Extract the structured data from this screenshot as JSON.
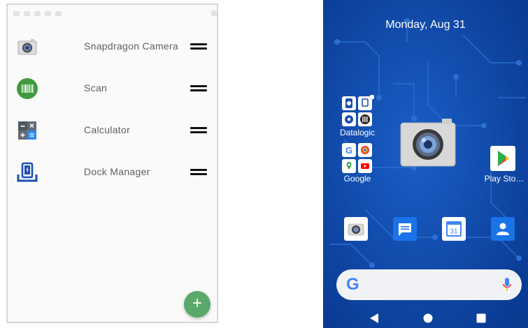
{
  "app_list": {
    "items": [
      {
        "label": "Snapdragon Camera",
        "icon": "camera-icon"
      },
      {
        "label": "Scan",
        "icon": "barcode-scan-icon"
      },
      {
        "label": "Calculator",
        "icon": "calculator-icon"
      },
      {
        "label": "Dock Manager",
        "icon": "dock-manager-icon"
      }
    ],
    "add_button": "+"
  },
  "home_screen": {
    "date": "Monday, Aug 31",
    "folders": [
      {
        "label": "Datalogic"
      },
      {
        "label": "Google"
      }
    ],
    "play_store_label": "Play Sto…",
    "calendar_day": "31",
    "search_g": "G"
  },
  "colors": {
    "wallpaper": "#0b3f9c",
    "fab": "#5aa86a",
    "google_blue": "#4285f4"
  }
}
